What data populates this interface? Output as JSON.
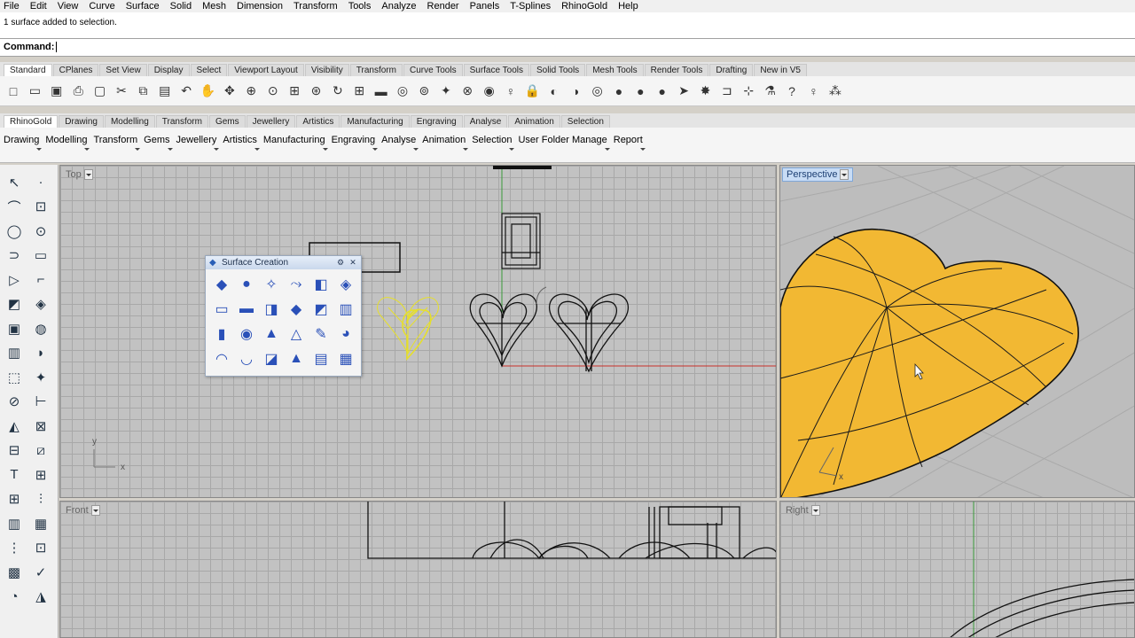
{
  "menu": [
    "File",
    "Edit",
    "View",
    "Curve",
    "Surface",
    "Solid",
    "Mesh",
    "Dimension",
    "Transform",
    "Tools",
    "Analyze",
    "Render",
    "Panels",
    "T-Splines",
    "RhinoGold",
    "Help"
  ],
  "history_text": "1 surface added to selection.",
  "command_label": "Command:",
  "tabs1": [
    "Standard",
    "CPlanes",
    "Set View",
    "Display",
    "Select",
    "Viewport Layout",
    "Visibility",
    "Transform",
    "Curve Tools",
    "Surface Tools",
    "Solid Tools",
    "Mesh Tools",
    "Render Tools",
    "Drafting",
    "New in V5"
  ],
  "tabs2": [
    "RhinoGold",
    "Drawing",
    "Modelling",
    "Transform",
    "Gems",
    "Jewellery",
    "Artistics",
    "Manufacturing",
    "Engraving",
    "Analyse",
    "Animation",
    "Selection"
  ],
  "toolbar2": [
    "Drawing",
    "Modelling",
    "Transform",
    "Gems",
    "Jewellery",
    "Artistics",
    "Manufacturing",
    "Engraving",
    "Analyse",
    "Animation",
    "Selection",
    "User Folder Manage",
    "Report"
  ],
  "toolbar1_icons": [
    "new-icon",
    "open-icon",
    "save-icon",
    "print-icon",
    "import-icon",
    "cut-icon",
    "copy-icon",
    "paste-icon",
    "undo-icon",
    "pan-icon",
    "move-icon",
    "zoom-icon",
    "zoom-window-icon",
    "zoom-extents-icon",
    "zoom-selected-icon",
    "rotate-view-icon",
    "four-viewports-icon",
    "cplane-icon",
    "layer-icon",
    "properties-icon",
    "lights-icon",
    "select-icon",
    "color-wheel-icon",
    "lightbulb-icon",
    "lock-icon",
    "render-color-icon",
    "material-icon",
    "color-circle-icon",
    "sphere-render-icon",
    "sphere-shaded-icon",
    "sphere-blue-icon",
    "gumball-icon",
    "settings-gear-icon",
    "grid-snap-icon",
    "osnap-icon",
    "history-icon",
    "help-icon",
    "stick-figure-icon",
    "network-icon"
  ],
  "left_icons": [
    "select-arrow-icon",
    "point-icon",
    "polyline-icon",
    "curve-icon",
    "circle-icon",
    "ellipse-icon",
    "arc-icon",
    "rectangle-icon",
    "polygon-icon",
    "fillet-icon",
    "surface-icon",
    "surface-edit-icon",
    "box-icon",
    "sphere-icon",
    "extrude-icon",
    "boolean-icon",
    "explode-icon",
    "star-icon",
    "trim-icon",
    "split-icon",
    "blend-icon",
    "analyze-icon",
    "rebuild-icon",
    "offset-icon",
    "text-icon",
    "dimension-icon",
    "array-icon",
    "mirror-icon",
    "cylinder-icon",
    "layout-icon",
    "grid-icon",
    "hatch-icon",
    "checklist-icon",
    "check-icon",
    "render-icon",
    "light-icon"
  ],
  "palette": {
    "title": "Surface Creation",
    "icons": [
      "patch-icon",
      "sphere-surface-icon",
      "loft-icon",
      "sweep-icon",
      "plane-surface-icon",
      "network-surface-icon",
      "revolve-icon",
      "planar-icon",
      "edge-surface-icon",
      "extrude-surface-icon",
      "rail-revolve-icon",
      "blend-surface-icon",
      "cylinder-surface-icon",
      "cone-surface-icon",
      "torus-icon",
      "pyramid-icon",
      "pipe-icon",
      "drape-icon",
      "sweep1-icon",
      "sweep2-icon",
      "heightfield-icon",
      "dome-icon",
      "panel-icon",
      "grid-surface-icon"
    ]
  },
  "viewports": {
    "top": "Top",
    "perspective": "Perspective",
    "front": "Front",
    "right": "Right"
  },
  "colors": {
    "surface": "#f2b833",
    "selected": "#f5f03a",
    "x_axis": "#c8302a",
    "y_axis": "#3a9a3a"
  }
}
